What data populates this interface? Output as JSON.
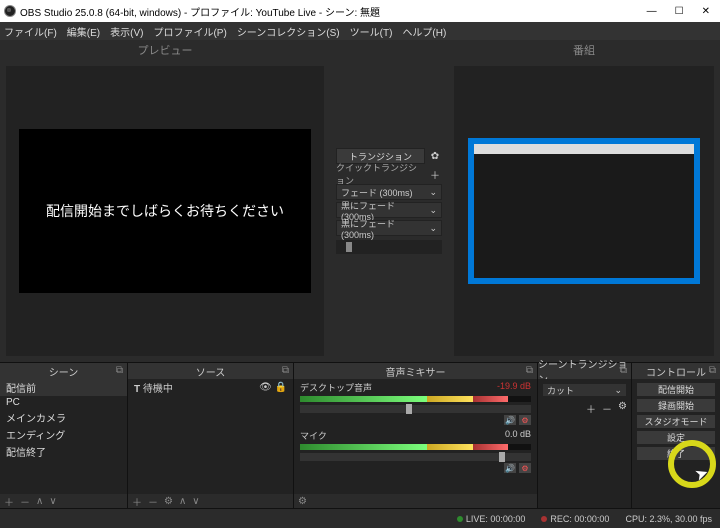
{
  "titlebar": {
    "title": "OBS Studio 25.0.8 (64-bit, windows) - プロファイル: YouTube Live - シーン: 無題"
  },
  "menu": {
    "file": "ファイル(F)",
    "edit": "編集(E)",
    "view": "表示(V)",
    "profile": "プロファイル(P)",
    "sceneCollection": "シーンコレクション(S)",
    "tools": "ツール(T)",
    "help": "ヘルプ(H)"
  },
  "preview": {
    "label": "プレビュー",
    "message": "配信開始までしばらくお待ちください"
  },
  "program": {
    "label": "番組"
  },
  "transitions": {
    "main": "トランジション",
    "quick": "クイックトランジション",
    "fade": "フェード (300ms)",
    "fadeBlack1": "黒にフェード (300ms)",
    "fadeBlack2": "黒にフェード (300ms)"
  },
  "docks": {
    "scenes": {
      "title": "シーン",
      "items": [
        "配信前",
        "PC",
        "メインカメラ",
        "エンディング",
        "配信終了"
      ]
    },
    "sources": {
      "title": "ソース",
      "items": [
        {
          "icon": "T",
          "name": "待機中"
        }
      ]
    },
    "mixer": {
      "title": "音声ミキサー",
      "channels": [
        {
          "name": "デスクトップ音声",
          "db": "-19.9 dB",
          "faderPos": 46
        },
        {
          "name": "マイク",
          "db": "0.0 dB",
          "faderPos": 86
        }
      ]
    },
    "sceneTransitions": {
      "title": "シーントランジション",
      "current": "カット"
    },
    "controls": {
      "title": "コントロール",
      "buttons": [
        "配信開始",
        "録画開始",
        "スタジオモード",
        "設定",
        "終了"
      ]
    }
  },
  "status": {
    "live": "LIVE: 00:00:00",
    "rec": "REC: 00:00:00",
    "cpu": "CPU: 2.3%, 30.00 fps"
  }
}
